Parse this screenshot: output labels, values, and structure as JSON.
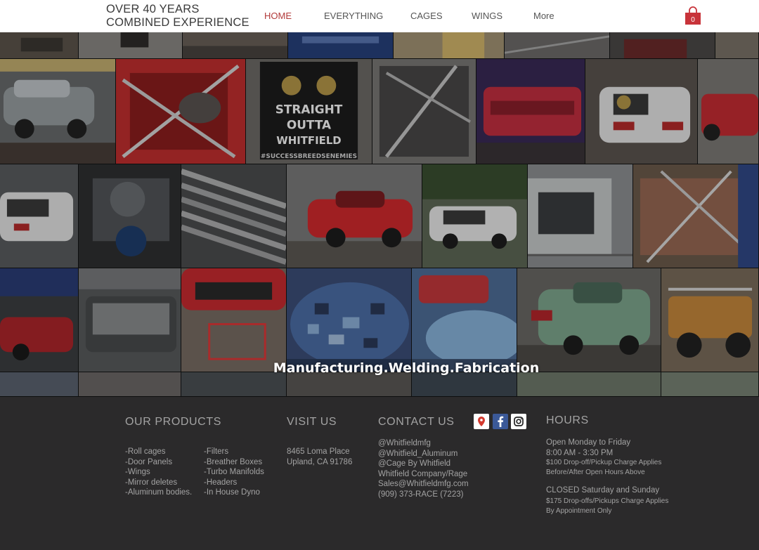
{
  "header": {
    "brand_line1": "OVER 40 YEARS",
    "brand_line2": "COMBINED EXPERIENCE",
    "nav": [
      "HOME",
      "EVERYTHING",
      "CAGES",
      "WINGS",
      "More"
    ],
    "active_nav": "HOME",
    "cart_count": "0",
    "accent_color": "#c8333a"
  },
  "hero": {
    "tagline": "Manufacturing.Welding.Fabrication",
    "tile_texts": {
      "sign_line1": "STRAIGHT",
      "sign_line2": "OUTTA",
      "sign_line3": "WHITFIELD",
      "sign_hashtag": "#SUCCESSBREEDSENEMIES"
    }
  },
  "footer": {
    "products_title": "OUR PRODUCTS",
    "products_col1": [
      "-Roll cages",
      "-Door Panels",
      "-Wings",
      "-Mirror deletes",
      "-Aluminum bodies."
    ],
    "products_col2": [
      "-Filters",
      "-Breather Boxes",
      "-Turbo Manifolds",
      "-Headers",
      "-In House Dyno"
    ],
    "visit_title": "VISIT US",
    "address_line1": "8465 Loma Place",
    "address_line2": "Upland, CA 91786",
    "contact_title": "CONTACT US",
    "contact_lines": [
      "@Whitfieldmfg",
      "@Whitfield_Aluminum",
      "@Cage By Whitfield",
      "Whitfield Company/Rage",
      "Sales@Whitfieldmfg.com",
      "(909) 373-RACE (7223)"
    ],
    "social_icons": [
      "map-pin-icon",
      "facebook-icon",
      "instagram-icon"
    ],
    "hours_title": "HOURS",
    "hours_line1": "Open Monday to Friday",
    "hours_line2": "8:00 AM - 3:30 PM",
    "hours_line3": "$100 Drop-off/Pickup Charge Applies",
    "hours_line4": "Before/After Open Hours Above",
    "hours_line5": "CLOSED Saturday and Sunday",
    "hours_line6": "$175 Drop-offs/Pickups Charge Applies",
    "hours_line7": "By Appointment Only"
  }
}
